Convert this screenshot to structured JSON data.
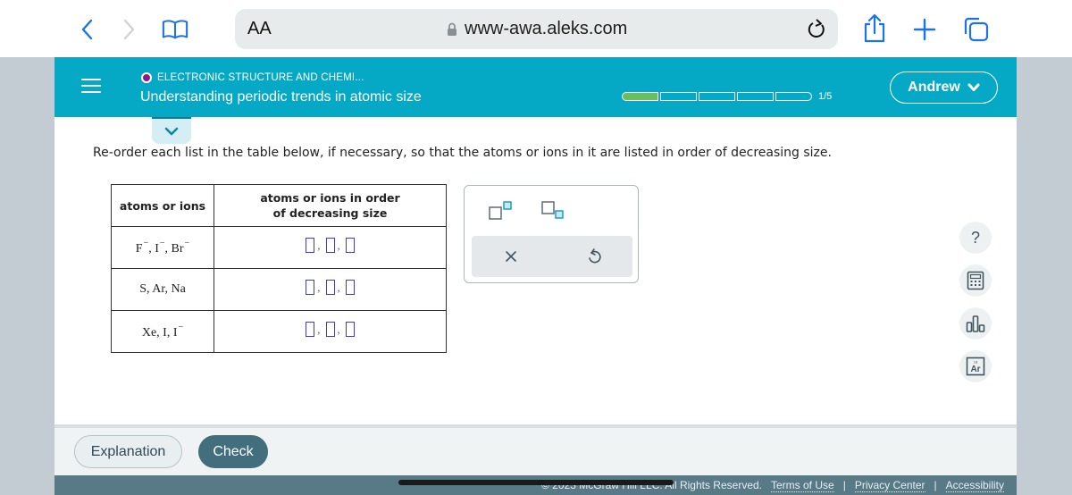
{
  "browser": {
    "text_size_label": "AA",
    "url": "www-awa.aleks.com",
    "icons": [
      "back-icon",
      "forward-icon",
      "bookmarks-icon",
      "lock-icon",
      "reload-icon",
      "share-icon",
      "new-tab-icon",
      "tabs-icon"
    ]
  },
  "header": {
    "topic": "ELECTRONIC STRUCTURE AND CHEMI...",
    "title": "Understanding periodic trends in atomic size",
    "progress": {
      "completed": 1,
      "total": 5,
      "label": "1/5"
    },
    "user_name": "Andrew",
    "colors": {
      "bar": "#06a9c5",
      "progress_fill": "#6cbd5e",
      "topic_dot": "#8a1a8e"
    }
  },
  "question": {
    "instruction": "Re-order each list in the table below, if necessary, so that the atoms or ions in it are listed in order of decreasing size.",
    "table": {
      "headers": [
        "atoms or ions",
        "atoms or ions in order of decreasing size"
      ],
      "header2_line1": "atoms or ions in order",
      "header2_line2": "of decreasing size",
      "rows": [
        {
          "species": [
            {
              "symbol": "F",
              "charge": "−"
            },
            {
              "symbol": "I",
              "charge": "−"
            },
            {
              "symbol": "Br",
              "charge": "−"
            }
          ],
          "answers": [
            "",
            "",
            ""
          ]
        },
        {
          "species": [
            {
              "symbol": "S",
              "charge": ""
            },
            {
              "symbol": "Ar",
              "charge": ""
            },
            {
              "symbol": "Na",
              "charge": ""
            }
          ],
          "answers": [
            "",
            "",
            ""
          ]
        },
        {
          "species": [
            {
              "symbol": "Xe",
              "charge": ""
            },
            {
              "symbol": "I",
              "charge": ""
            },
            {
              "symbol": "I",
              "charge": "−"
            }
          ],
          "answers": [
            "",
            "",
            ""
          ]
        }
      ]
    },
    "palette": {
      "tools": [
        "superscript-tool",
        "subscript-tool"
      ],
      "actions": [
        "clear",
        "undo"
      ],
      "clear_glyph": "×"
    }
  },
  "side_tools": [
    {
      "name": "help",
      "glyph": "?"
    },
    {
      "name": "calculator"
    },
    {
      "name": "data-chart"
    },
    {
      "name": "periodic-table",
      "glyph": "Ar"
    }
  ],
  "footer": {
    "explanation_label": "Explanation",
    "check_label": "Check",
    "copyright": "© 2023 McGraw Hill LLC. All Rights Reserved.",
    "links": [
      "Terms of Use",
      "Privacy Center",
      "Accessibility"
    ],
    "separator": "|"
  }
}
